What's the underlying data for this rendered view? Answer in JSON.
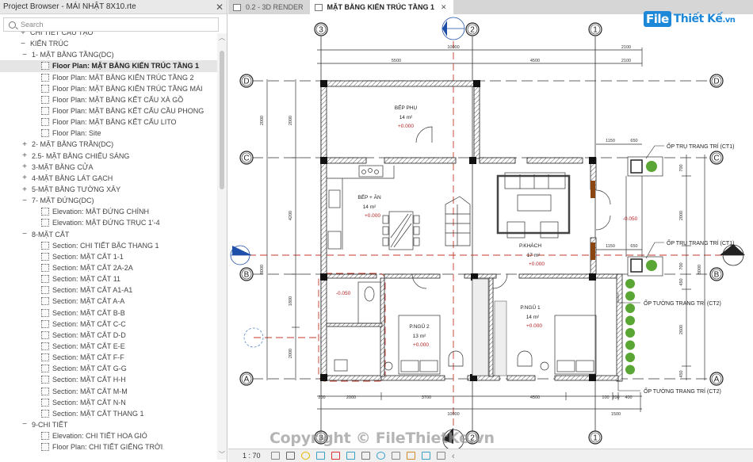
{
  "project_browser": {
    "title": "Project Browser - MÁI NHẬT 8X10.rte",
    "search_placeholder": "Search",
    "nodes": [
      {
        "level": 0,
        "toggle": "+",
        "label": "CHI TIẾT CẤU TẠO",
        "type": "group"
      },
      {
        "level": 0,
        "toggle": "−",
        "label": "KIẾN TRÚC",
        "type": "group"
      },
      {
        "level": 1,
        "toggle": "−",
        "label": "1- MẶT BẰNG TẦNG(DC)",
        "type": "group"
      },
      {
        "level": 2,
        "label": "Floor Plan: MẶT BẰNG KIẾN TRÚC TẦNG 1",
        "type": "view",
        "selected": true
      },
      {
        "level": 2,
        "label": "Floor Plan: MẶT BẰNG KIẾN TRÚC TẦNG 2",
        "type": "view"
      },
      {
        "level": 2,
        "label": "Floor Plan: MẶT BẰNG KIẾN TRÚC TẦNG MÁI",
        "type": "view"
      },
      {
        "level": 2,
        "label": "Floor Plan: MẶT BẰNG KẾT CẤU XÀ GỒ",
        "type": "view"
      },
      {
        "level": 2,
        "label": "Floor Plan: MẶT BẰNG KẾT CẤU CẦU PHONG",
        "type": "view"
      },
      {
        "level": 2,
        "label": "Floor Plan: MẶT BẰNG KẾT CẤU LITO",
        "type": "view"
      },
      {
        "level": 2,
        "label": "Floor Plan: Site",
        "type": "view"
      },
      {
        "level": 1,
        "toggle": "+",
        "label": "2- MẶT BẰNG TRẦN(DC)",
        "type": "group"
      },
      {
        "level": 1,
        "toggle": "+",
        "label": "2.5- MẶT BẰNG CHIẾU SÁNG",
        "type": "group"
      },
      {
        "level": 1,
        "toggle": "+",
        "label": "3-MẶT BẰNG CỬA",
        "type": "group"
      },
      {
        "level": 1,
        "toggle": "+",
        "label": "4-MẶT BẰNG LÁT GẠCH",
        "type": "group"
      },
      {
        "level": 1,
        "toggle": "+",
        "label": "5-MẶT BẰNG TƯỜNG XÂY",
        "type": "group"
      },
      {
        "level": 1,
        "toggle": "−",
        "label": "7- MẶT ĐỨNG(DC)",
        "type": "group"
      },
      {
        "level": 2,
        "label": "Elevation: MẶT ĐỨNG CHÍNH",
        "type": "view"
      },
      {
        "level": 2,
        "label": "Elevation: MẶT ĐỨNG TRỤC 1'-4",
        "type": "view"
      },
      {
        "level": 1,
        "toggle": "−",
        "label": "8-MẶT CẮT",
        "type": "group"
      },
      {
        "level": 2,
        "label": "Section: CHI TIẾT BẬC THANG 1",
        "type": "view"
      },
      {
        "level": 2,
        "label": "Section: MẶT CẮT 1-1",
        "type": "view"
      },
      {
        "level": 2,
        "label": "Section: MẶT CẮT 2A-2A",
        "type": "view"
      },
      {
        "level": 2,
        "label": "Section: MẶT CẮT 11",
        "type": "view"
      },
      {
        "level": 2,
        "label": "Section: MẶT CẮT A1-A1",
        "type": "view"
      },
      {
        "level": 2,
        "label": "Section: MẶT CẮT A-A",
        "type": "view"
      },
      {
        "level": 2,
        "label": "Section: MẶT CẮT B-B",
        "type": "view"
      },
      {
        "level": 2,
        "label": "Section: MẶT CẮT C-C",
        "type": "view"
      },
      {
        "level": 2,
        "label": "Section: MẶT CẮT D-D",
        "type": "view"
      },
      {
        "level": 2,
        "label": "Section: MẶT CẮT E-E",
        "type": "view"
      },
      {
        "level": 2,
        "label": "Section: MẶT CẮT F-F",
        "type": "view"
      },
      {
        "level": 2,
        "label": "Section: MẶT CẮT G-G",
        "type": "view"
      },
      {
        "level": 2,
        "label": "Section: MẶT CẮT H-H",
        "type": "view"
      },
      {
        "level": 2,
        "label": "Section: MẶT CẮT M-M",
        "type": "view"
      },
      {
        "level": 2,
        "label": "Section: MẶT CẮT N-N",
        "type": "view"
      },
      {
        "level": 2,
        "label": "Section: MẶT CẮT THANG 1",
        "type": "view"
      },
      {
        "level": 1,
        "toggle": "−",
        "label": "9-CHI TIẾT",
        "type": "group"
      },
      {
        "level": 2,
        "label": "Elevation: CHI TIẾT HOA GIÓ",
        "type": "view"
      },
      {
        "level": 2,
        "label": "Floor Plan: CHI TIẾT GIẾNG TRỜI",
        "type": "view"
      }
    ]
  },
  "tabs": [
    {
      "label": "0.2 - 3D RENDER",
      "active": false
    },
    {
      "label": "MẶT BẰNG KIẾN TRÚC TẦNG 1",
      "active": true
    }
  ],
  "drawing": {
    "grid_columns": [
      "3",
      "2",
      "1"
    ],
    "grid_rows": [
      "D",
      "C",
      "B",
      "A"
    ],
    "dims_top": {
      "overall": "10000",
      "seg1": "5500",
      "seg2": "4500",
      "right1": "2100",
      "right2": "2100"
    },
    "dims_bottom": {
      "overall": "10000",
      "segs": [
        "200",
        "2000",
        "3700",
        "4500",
        "100",
        "200",
        "400"
      ],
      "right": "1500"
    },
    "dims_left": {
      "outer": "8000",
      "inner": [
        "2000",
        "4200",
        "1800",
        "2000"
      ]
    },
    "dims_right": {
      "outer": "8000",
      "inner": [
        "700",
        "2000",
        "700",
        "450",
        "2600",
        "450"
      ]
    },
    "dims_annex": [
      "1150",
      "650",
      "1150",
      "650"
    ],
    "rooms": [
      {
        "name": "BẾP PHỤ",
        "area": "14 m²",
        "level": "+0.000"
      },
      {
        "name": "BẾP + ĂN",
        "area": "14 m²",
        "level": "+0.000"
      },
      {
        "name": "P.KHÁCH",
        "area": "17 m²",
        "level": "+0.000"
      },
      {
        "name": "P.NGỦ 2",
        "area": "13 m²",
        "level": "+0.000"
      },
      {
        "name": "P.NGỦ 1",
        "area": "14 m²",
        "level": "+0.000"
      }
    ],
    "level_marks": [
      "-0.050",
      "-0.050"
    ],
    "annotations": [
      "ỐP TRỤ TRANG TRÍ (CT1)",
      "ỐP TRỤ TRANG TRÍ (CT1)",
      "ỐP TƯỜNG TRANG TRÍ (CT2)",
      "ỐP TƯỜNG TRANG TRÍ (CT2)"
    ]
  },
  "status_bar": {
    "scale": "1 : 70",
    "icons": [
      "detail-level-icon",
      "visual-style-icon",
      "sun-path-icon",
      "shadows-icon",
      "crop-view-icon",
      "show-crop-icon",
      "unlock-3d-icon",
      "temporary-hide-icon",
      "reveal-hidden-icon",
      "temporary-view-properties-icon",
      "analytical-model-icon",
      "constraints-icon",
      "collapse-icon"
    ]
  },
  "watermark": {
    "logo_file": "File",
    "logo_rest": "Thiết Kế",
    "logo_tld": ".vn",
    "copyright": "Copyright © FileThietKe.vn"
  },
  "colors": {
    "accent_blue": "#1e88d8",
    "level_red": "#b22222",
    "section_blue": "#1f4fa8",
    "plant_green": "#4a9a2a"
  }
}
